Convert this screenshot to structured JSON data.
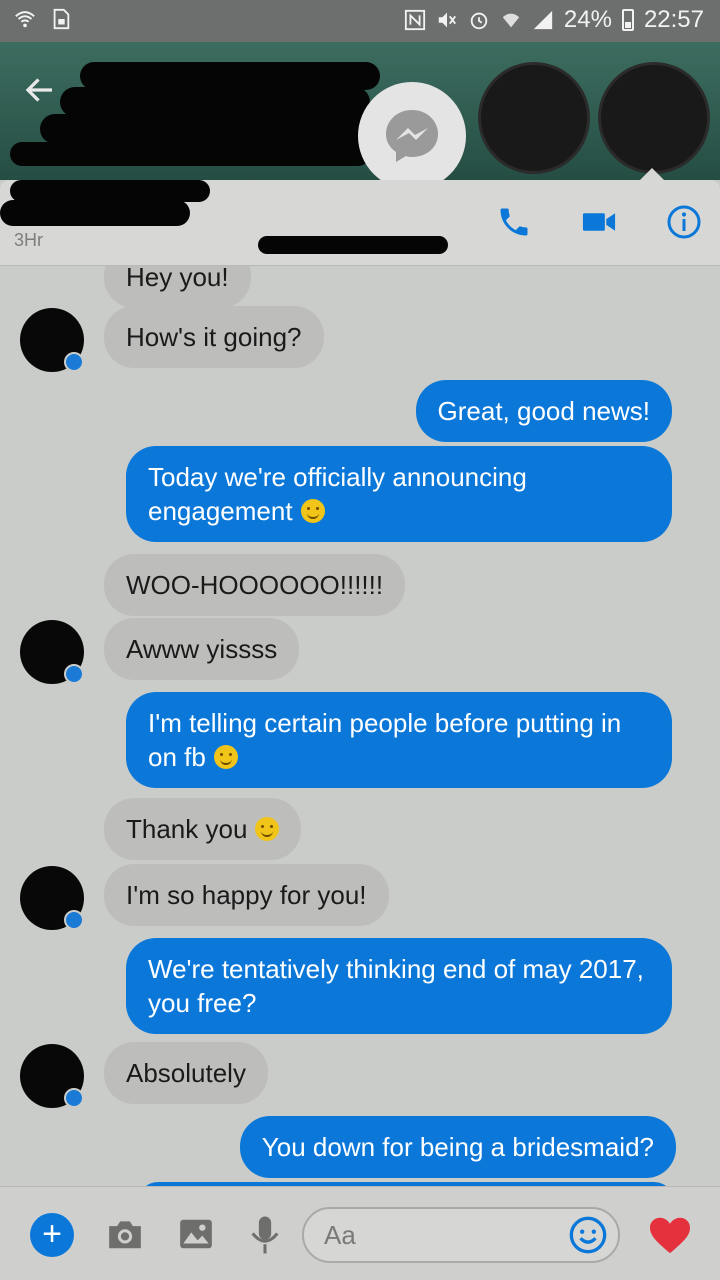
{
  "status_bar": {
    "battery": "24%",
    "time": "22:57"
  },
  "header": {
    "back_icon": "arrow-left-icon",
    "badge_icon": "messenger-icon"
  },
  "infobar": {
    "active_status": "3Hr",
    "call_icon": "phone-icon",
    "video_icon": "video-camera-icon",
    "info_icon": "info-icon"
  },
  "messages": [
    {
      "side": "in",
      "text": "Hey you!"
    },
    {
      "side": "in",
      "text": "How's it going?"
    },
    {
      "side": "out",
      "text": "Great, good news!"
    },
    {
      "side": "out",
      "text": "Today we're officially announcing engagement",
      "emoji": "slightly-smiling-face"
    },
    {
      "side": "in",
      "text": "WOO-HOOOOOO!!!!!!"
    },
    {
      "side": "in",
      "text": "Awww yissss"
    },
    {
      "side": "out",
      "text": "I'm telling certain people before putting in on fb",
      "emoji": "smiling-face"
    },
    {
      "side": "in",
      "text": "Thank you",
      "emoji": "smiling-face-with-smiling-eyes"
    },
    {
      "side": "in",
      "text": "I'm so happy for you!"
    },
    {
      "side": "out",
      "text": "We're tentatively thinking end of may 2017, you free?"
    },
    {
      "side": "in",
      "text": "Absolutely"
    },
    {
      "side": "out",
      "text": "You down for being a bridesmaid?"
    }
  ],
  "composer": {
    "placeholder": "Aa",
    "add_icon": "plus-icon",
    "camera_icon": "camera-icon",
    "gallery_icon": "image-icon",
    "mic_icon": "microphone-icon",
    "emoji_icon": "emoji-smile-icon",
    "like_icon": "heart-icon"
  },
  "colors": {
    "accent": "#0b78d9",
    "incoming_bubble": "#bdbebc",
    "heart": "#e5303d"
  }
}
